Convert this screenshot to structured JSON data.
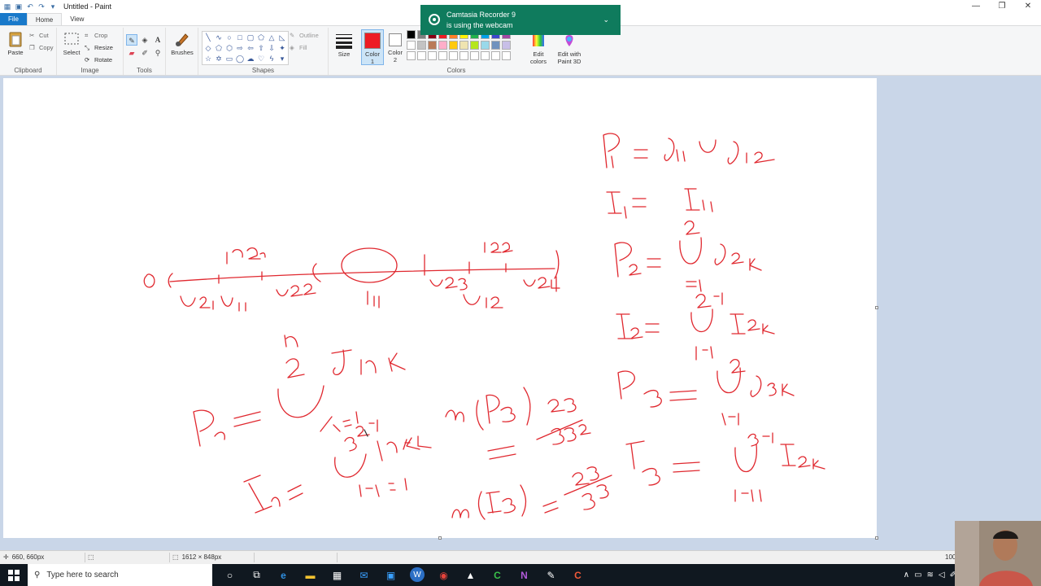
{
  "window": {
    "title": "Untitled - Paint",
    "controls": {
      "minimize": "—",
      "restore": "❐",
      "close": "✕"
    }
  },
  "tabs": [
    {
      "label": "File"
    },
    {
      "label": "Home"
    },
    {
      "label": "View"
    }
  ],
  "ribbon": {
    "clipboard": {
      "label": "Clipboard",
      "paste": "Paste",
      "cut": "Cut",
      "copy": "Copy"
    },
    "image": {
      "label": "Image",
      "select": "Select",
      "crop": "Crop",
      "resize": "Resize",
      "rotate": "Rotate"
    },
    "tools": {
      "label": "Tools"
    },
    "brushes": {
      "label": "Brushes"
    },
    "shapes": {
      "label": "Shapes",
      "outline": "Outline",
      "fill": "Fill"
    },
    "size": {
      "label": "Size"
    },
    "color1": {
      "label_line1": "Color",
      "label_line2": "1",
      "value": "#ed1c24"
    },
    "color2": {
      "label_line1": "Color",
      "label_line2": "2",
      "value": "#ffffff"
    },
    "colors": {
      "label": "Colors",
      "palette": [
        "#000000",
        "#7f7f7f",
        "#880015",
        "#ed1c24",
        "#ff7f27",
        "#fff200",
        "#22b14c",
        "#00a2e8",
        "#3f48cc",
        "#a349a4",
        "#ffffff",
        "#c3c3c3",
        "#b97a57",
        "#ffaec9",
        "#ffc90e",
        "#efe4b0",
        "#b5e61d",
        "#99d9ea",
        "#7092be",
        "#c8bfe7",
        "#ffffff",
        "#ffffff",
        "#ffffff",
        "#ffffff",
        "#ffffff",
        "#ffffff",
        "#ffffff",
        "#ffffff",
        "#ffffff",
        "#ffffff"
      ]
    },
    "edit_colors": {
      "line1": "Edit",
      "line2": "colors"
    },
    "edit_paint3d": {
      "line1": "Edit with",
      "line2": "Paint 3D"
    }
  },
  "toast": {
    "line1": "Camtasia Recorder 9",
    "line2": "is using the webcam"
  },
  "statusbar": {
    "cursor": "660, 660px",
    "image_size": "1612 × 848px",
    "zoom": "100"
  },
  "taskbar": {
    "search_placeholder": "Type here to search"
  },
  "colors": {
    "ink": "#e0282f",
    "accent": "#1979ca",
    "toast_bg": "#0f7b5d"
  }
}
